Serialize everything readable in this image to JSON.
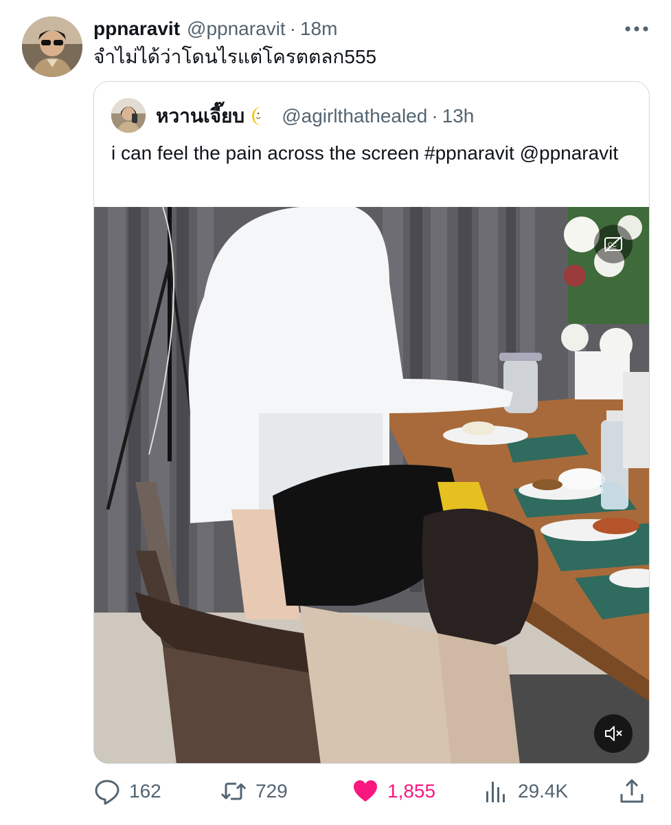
{
  "tweet": {
    "display_name": "ppnaravit",
    "handle": "@ppnaravit",
    "separator": "·",
    "time": "18m",
    "text": "จำไม่ได้ว่าโดนไรแต่โครตตลก555",
    "more_icon": "more-horizontal-icon"
  },
  "quoted": {
    "display_name": "หวานเจี๊ยบ",
    "emoji_icon": "crescent-moon-icon",
    "handle": "@agirlthathealed",
    "separator": "·",
    "time": "13h",
    "text": "i can feel the pain across the screen #ppnaravit @ppnaravit",
    "media": {
      "type": "video",
      "captions_icon": "captions-off-icon",
      "mute_icon": "muted-speaker-icon"
    }
  },
  "actions": {
    "replies": "162",
    "retweets": "729",
    "likes": "1,855",
    "views": "29.4K",
    "like_color": "#f91880",
    "muted_color": "#536471"
  }
}
